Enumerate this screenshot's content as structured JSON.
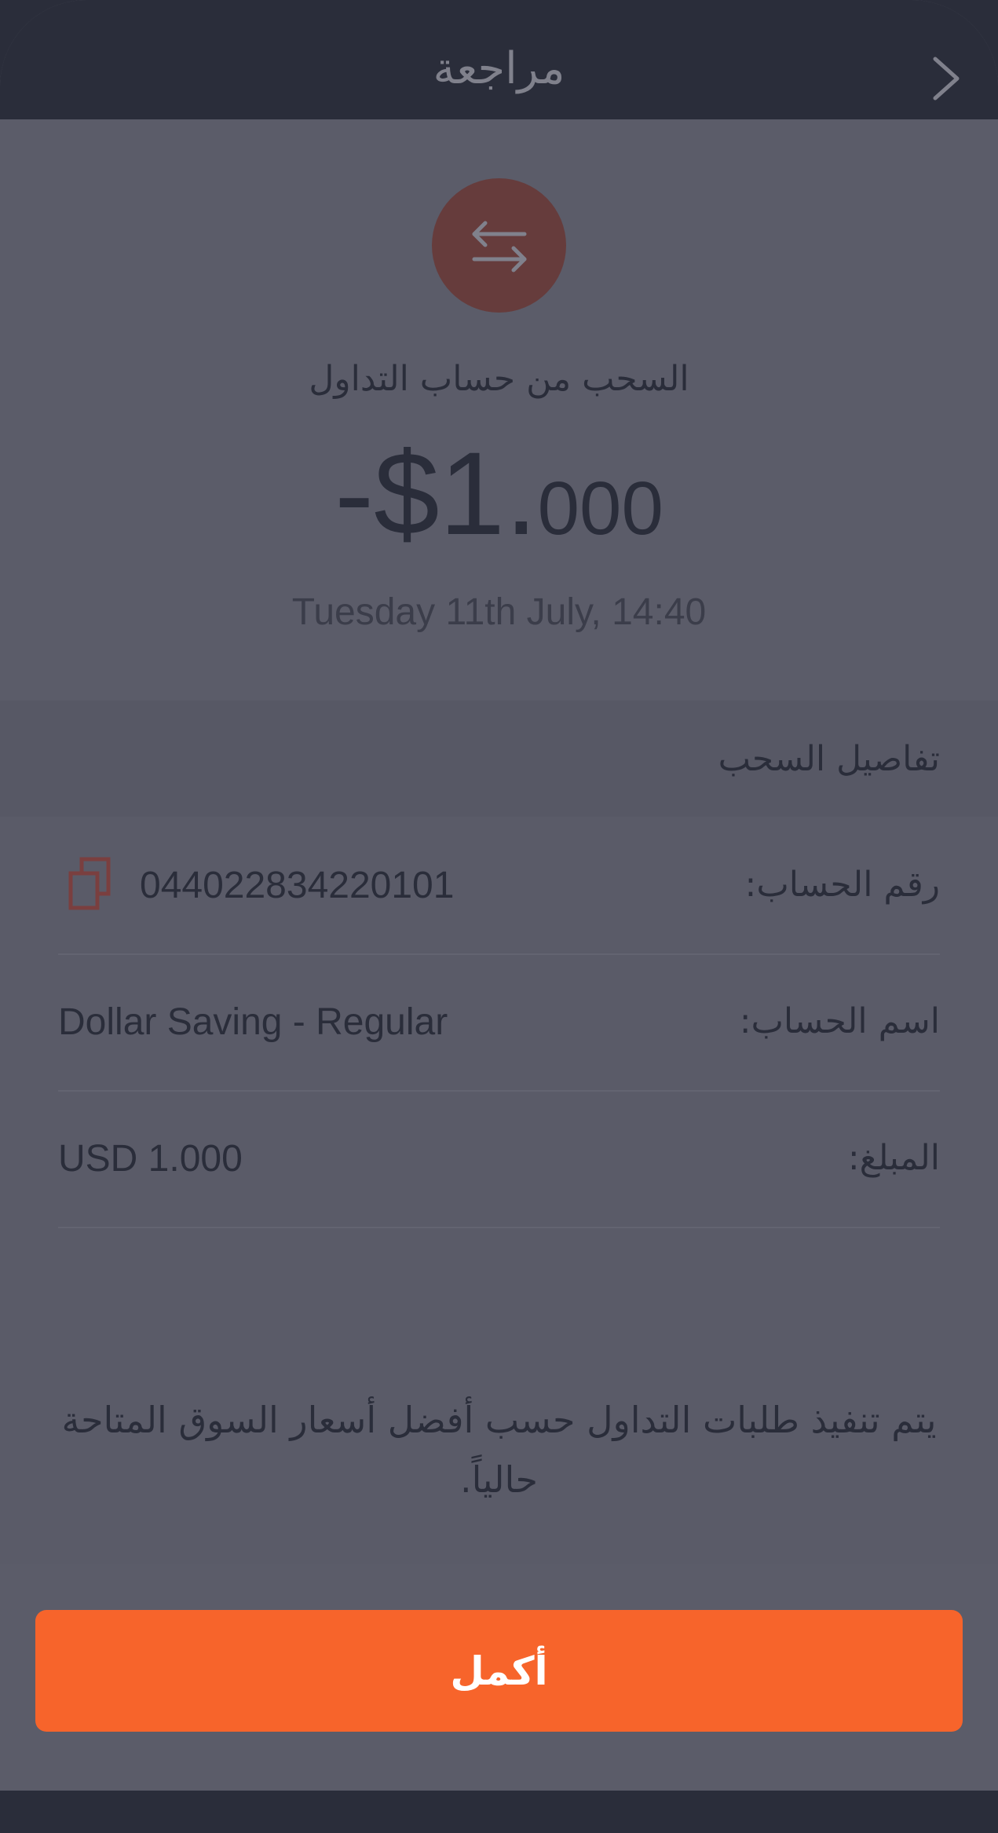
{
  "header": {
    "title": "مراجعة",
    "back_icon": "chevron-right-icon"
  },
  "hero": {
    "icon": "swap-arrows-icon",
    "title": "السحب من حساب التداول",
    "amount_main": "-$1.",
    "amount_decimals": "000",
    "datetime": "Tuesday 11th July, 14:40"
  },
  "details": {
    "title": "تفاصيل السحب",
    "rows": [
      {
        "label": "رقم الحساب:",
        "value": "044022834220101",
        "copy_icon": "copy-icon"
      },
      {
        "label": "اسم الحساب:",
        "value": "Dollar Saving - Regular"
      },
      {
        "label": "المبلغ:",
        "value": "USD 1.000"
      }
    ]
  },
  "notice": "يتم تنفيذ طلبات التداول حسب أفضل أسعار السوق المتاحة حالياً.",
  "cta": {
    "label": "أكمل"
  },
  "colors": {
    "accent": "#f7642b",
    "header_bg": "#2a2d3a",
    "overlay_bg": "#5b5c69",
    "icon_bg": "#663c3c"
  }
}
